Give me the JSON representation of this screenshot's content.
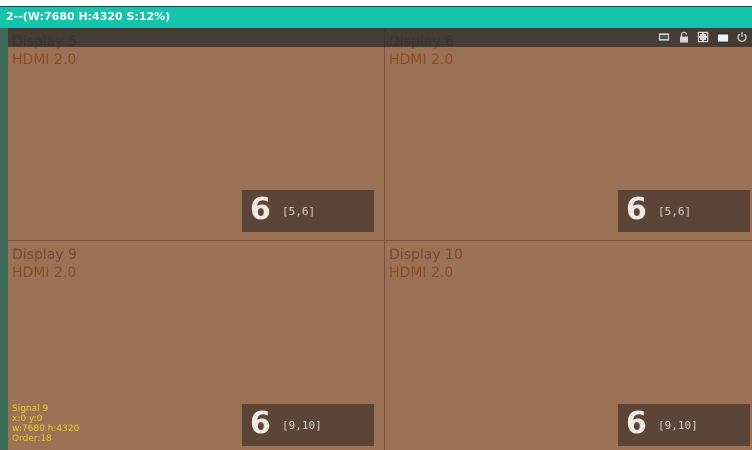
{
  "window": {
    "title": "2--(W:7680 H:4320 S:12%)"
  },
  "toolbar": {
    "icons": [
      "hdmi-input-icon",
      "lock-icon",
      "fullscreen-icon",
      "window-icon",
      "power-icon"
    ]
  },
  "displays": [
    {
      "name": "Display 5",
      "signal": "HDMI 2.0",
      "badge_number": "6",
      "badge_range": "[5,6]"
    },
    {
      "name": "Display 6",
      "signal": "HDMI 2.0",
      "badge_number": "6",
      "badge_range": "[5,6]"
    },
    {
      "name": "Display 9",
      "signal": "HDMI 2.0",
      "badge_number": "6",
      "badge_range": "[9,10]"
    },
    {
      "name": "Display 10",
      "signal": "HDMI 2.0",
      "badge_number": "6",
      "badge_range": "[9,10]"
    }
  ],
  "signal_info": {
    "signal": "Signal  9",
    "position": "x:0  y:0",
    "size": "w:7680  h:4320",
    "order": "Order:18"
  },
  "colors": {
    "titlebar": "#14c4ad",
    "wall_background": "#9c7257",
    "badge_background": "#5c4437",
    "info_text": "#e8d21c"
  }
}
